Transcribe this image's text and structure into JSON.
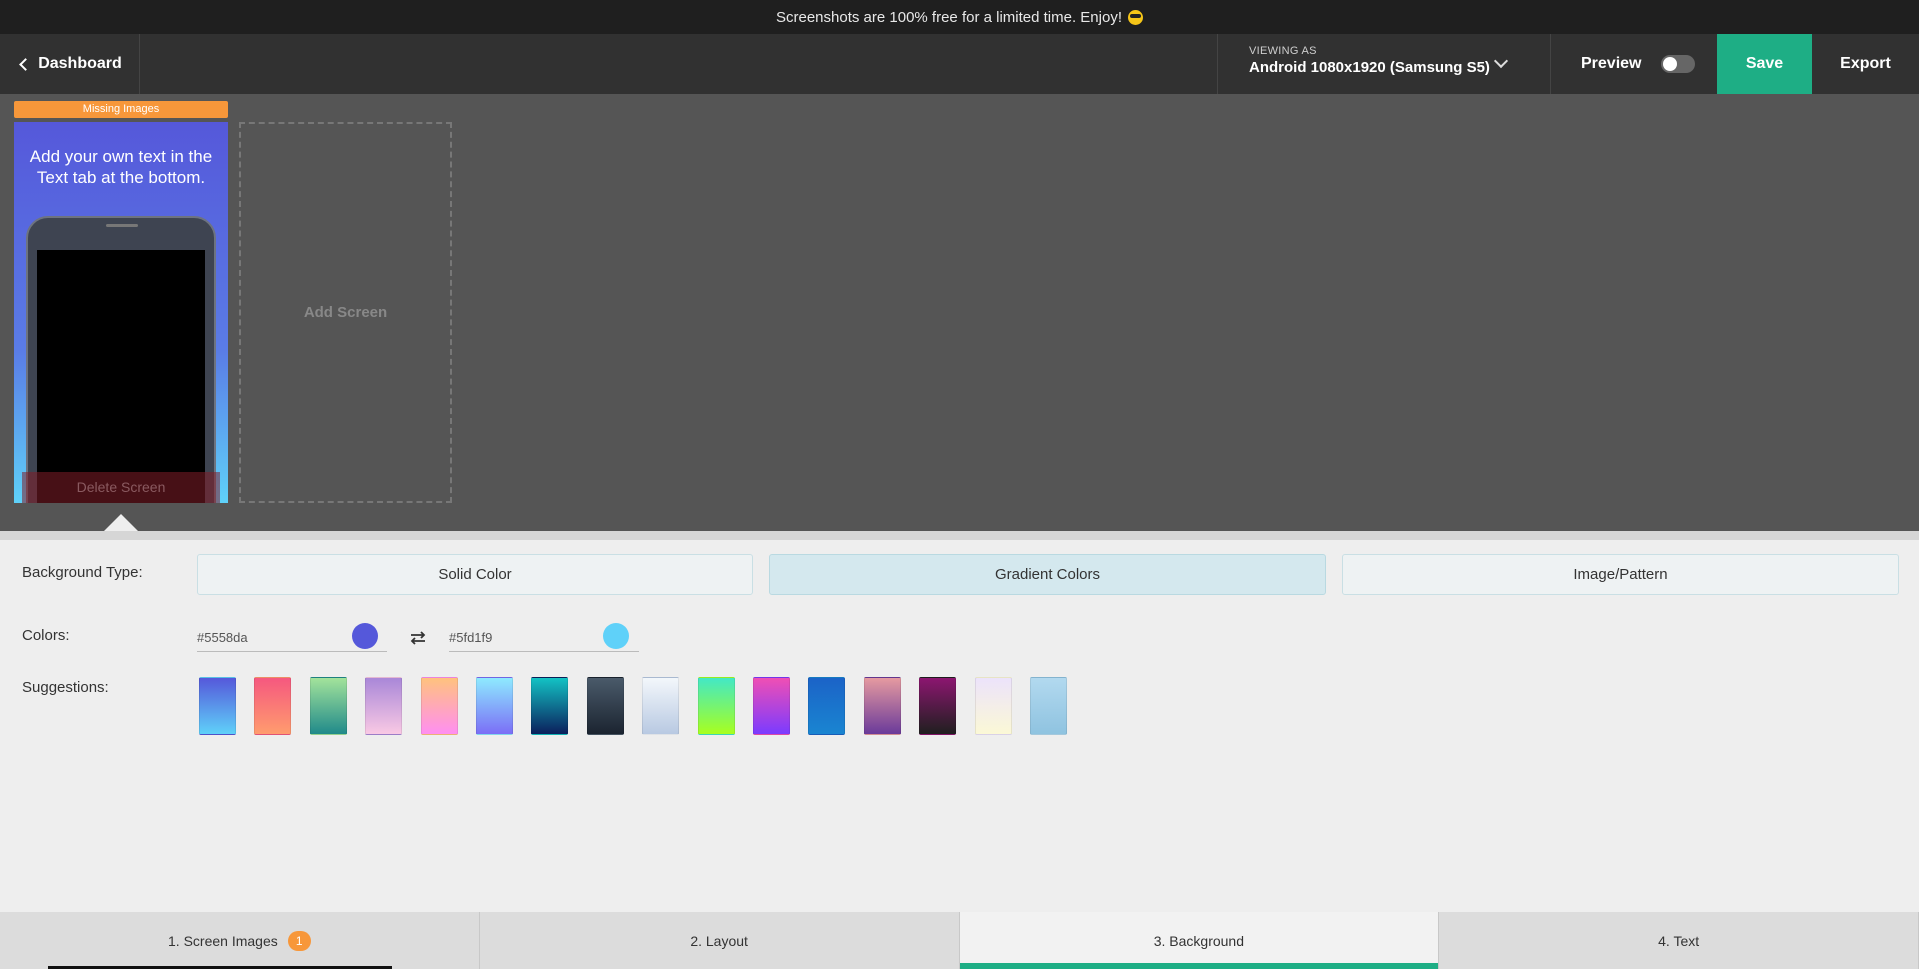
{
  "banner": {
    "text": "Screenshots are 100% free for a limited time. Enjoy!",
    "emoji_icon": "sunglasses-emoji-icon"
  },
  "header": {
    "back_label": "Dashboard",
    "device_label": "VIEWING AS",
    "device_value": "Android 1080x1920 (Samsung S5)",
    "preview_label": "Preview",
    "preview_enabled": false,
    "save_label": "Save",
    "export_label": "Export"
  },
  "canvas": {
    "missing_badge": "Missing Images",
    "screen_text": "Add your own text in the Text tab at the bottom.",
    "delete_label": "Delete Screen",
    "add_screen_label": "Add Screen"
  },
  "background": {
    "type_label": "Background Type:",
    "types": [
      "Solid Color",
      "Gradient Colors",
      "Image/Pattern"
    ],
    "active_type": "Gradient Colors",
    "colors_label": "Colors:",
    "color1": "#5558da",
    "color2": "#5fd1f9",
    "suggestions_label": "Suggestions:",
    "suggestions": [
      [
        "#5558da",
        "#5fd1f9"
      ],
      [
        "#f5587f",
        "#ff9c6e"
      ],
      [
        "#a3e39b",
        "#208a8a"
      ],
      [
        "#a987d8",
        "#f9c9e4"
      ],
      [
        "#ffc27e",
        "#ff8ff1"
      ],
      [
        "#8eeaff",
        "#7b6ef6"
      ],
      [
        "#13c2c4",
        "#0b1f5c"
      ],
      [
        "#4a5a6a",
        "#1b2430"
      ],
      [
        "#f3f7fb",
        "#b8c9e2"
      ],
      [
        "#43e8c5",
        "#a8ff1f"
      ],
      [
        "#ef4fb4",
        "#7b3bff"
      ],
      [
        "#1b63c7",
        "#1a85d1"
      ],
      [
        "#e59aa0",
        "#6a3a9a"
      ],
      [
        "#8c1670",
        "#1f1f1f"
      ],
      [
        "#ece3fb",
        "#fbf8d6"
      ],
      [
        "#b2d9ef",
        "#8fc3e0"
      ]
    ]
  },
  "tabs": [
    {
      "label": "1. Screen Images",
      "badge": "1"
    },
    {
      "label": "2. Layout",
      "badge": ""
    },
    {
      "label": "3. Background",
      "badge": ""
    },
    {
      "label": "4. Text",
      "badge": ""
    }
  ],
  "active_tab": "3. Background",
  "colors": {
    "accent": "#1eae85",
    "badge": "#f7973a",
    "header": "#313131",
    "canvas": "#555555"
  }
}
